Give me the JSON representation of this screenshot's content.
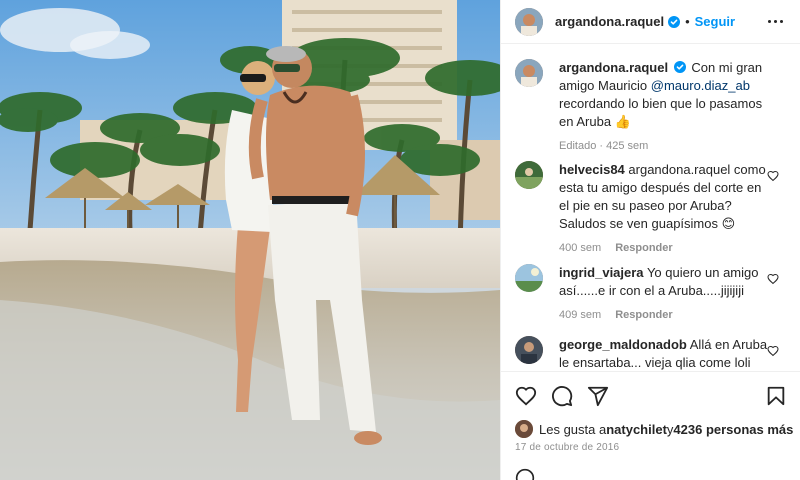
{
  "post": {
    "username": "argandona.raquel",
    "follow_label": "Seguir",
    "separator": "•"
  },
  "caption": {
    "username": "argandona.raquel",
    "text_before": "Con mi gran amigo Mauricio ",
    "mention": "@mauro.diaz_ab",
    "text_after": " recordando lo bien que lo pasamos en Aruba",
    "emoji": "👍",
    "edited_label": "Editado",
    "time": "425 sem"
  },
  "comments": [
    {
      "username": "helvecis84",
      "text": "argandona.raquel como esta tu amigo después del corte en el pie en su paseo por Aruba? Saludos se ven guapísimos",
      "emoji": "😊",
      "time": "400 sem",
      "reply_label": "Responder"
    },
    {
      "username": "ingrid_viajera",
      "text": "Yo quiero un amigo así......e ir con el a Aruba.....jijijiji",
      "emoji": "",
      "time": "409 sem",
      "reply_label": "Responder"
    },
    {
      "username": "george_maldonadob",
      "text": "Allá en Aruba le ensartaba... vieja qlia come loli",
      "emoji": "",
      "time": "",
      "reply_label": ""
    }
  ],
  "likes": {
    "prefix": "Les gusta a ",
    "user": "natychilet",
    "joiner": " y ",
    "others": "4236 personas más"
  },
  "date": "17 de octubre de 2016",
  "icons": {
    "verified": "verified-badge-icon",
    "more": "more-options-icon",
    "like": "heart-icon",
    "comment": "comment-icon",
    "share": "share-icon",
    "save": "bookmark-icon",
    "comment_like": "small-heart-icon"
  },
  "colors": {
    "accent": "#0095f6",
    "text": "#262626",
    "muted": "#8e8e8e",
    "mention": "#00376b",
    "border": "#efefef"
  }
}
